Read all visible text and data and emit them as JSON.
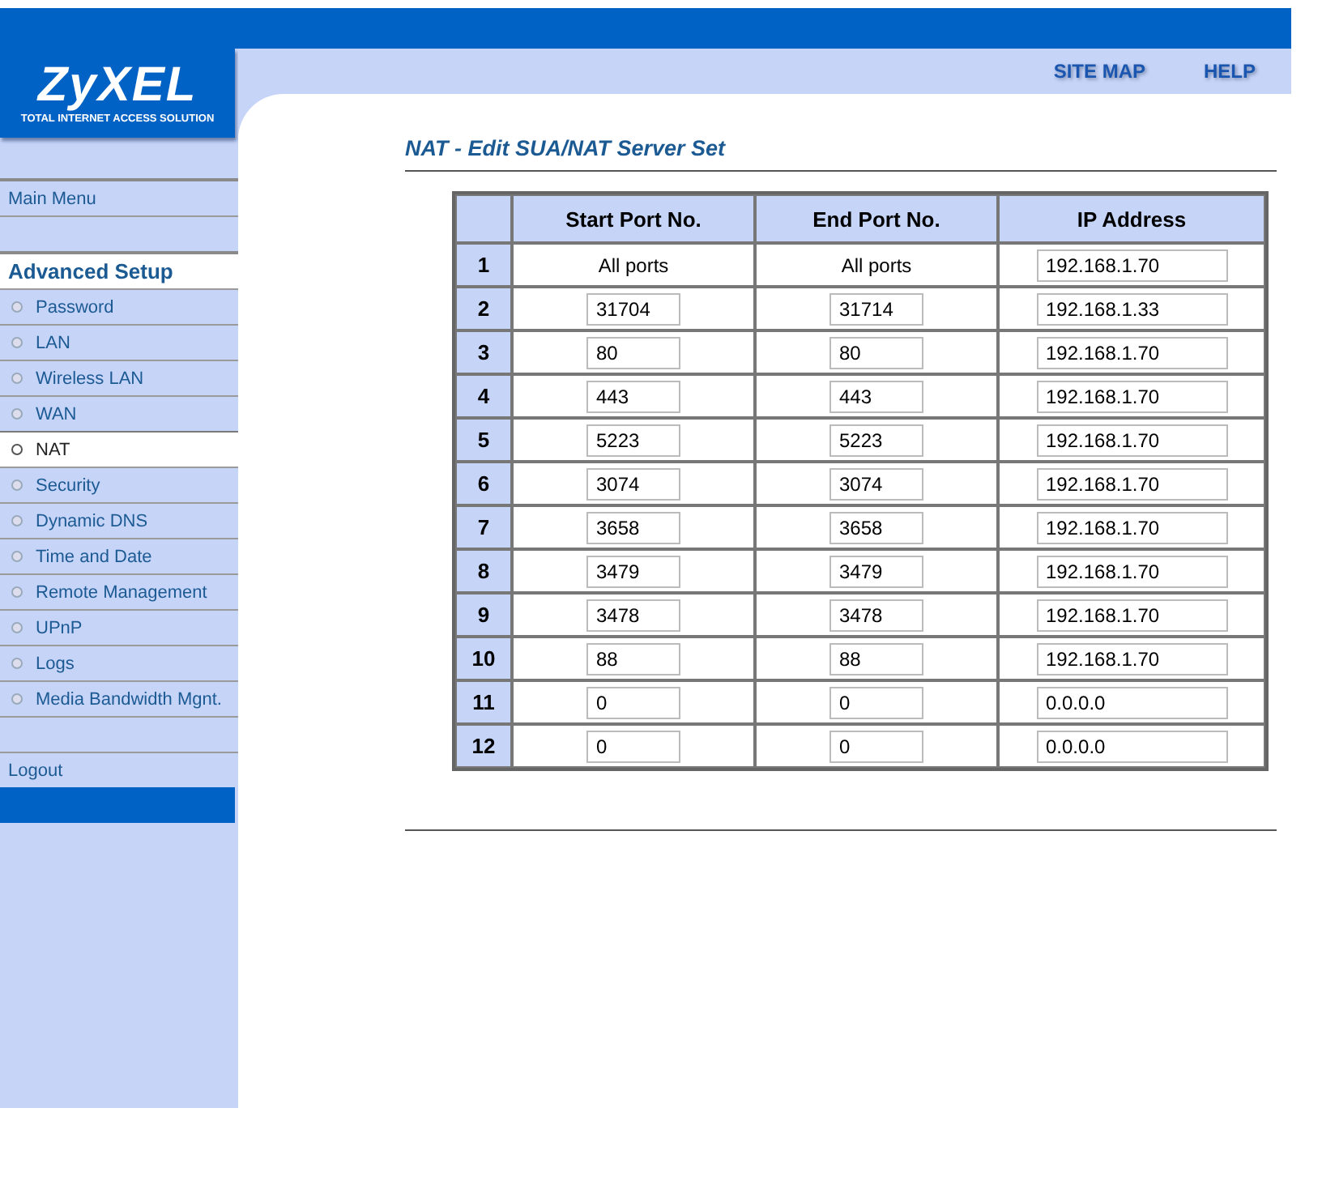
{
  "logo": {
    "brand": "ZyXEL",
    "tagline": "TOTAL INTERNET ACCESS SOLUTION"
  },
  "top_links": [
    "SITE MAP",
    "HELP"
  ],
  "sidebar": {
    "main_menu": "Main Menu",
    "section": "Advanced Setup",
    "items": [
      {
        "label": "Password",
        "selected": false
      },
      {
        "label": "LAN",
        "selected": false
      },
      {
        "label": "Wireless LAN",
        "selected": false
      },
      {
        "label": "WAN",
        "selected": false
      },
      {
        "label": "NAT",
        "selected": true
      },
      {
        "label": "Security",
        "selected": false
      },
      {
        "label": "Dynamic DNS",
        "selected": false
      },
      {
        "label": "Time and Date",
        "selected": false
      },
      {
        "label": "Remote Management",
        "selected": false
      },
      {
        "label": "UPnP",
        "selected": false
      },
      {
        "label": "Logs",
        "selected": false
      },
      {
        "label": "Media Bandwidth Mgnt.",
        "selected": false
      }
    ],
    "logout": "Logout"
  },
  "page_title": "NAT - Edit SUA/NAT Server Set",
  "table": {
    "columns": [
      "Start Port No.",
      "End Port No.",
      "IP Address"
    ],
    "rows": [
      {
        "number": "1",
        "start": {
          "kind": "text",
          "value": "All ports"
        },
        "end": {
          "kind": "text",
          "value": "All ports"
        },
        "ip": "192.168.1.70"
      },
      {
        "number": "2",
        "start": {
          "kind": "input",
          "value": "31704"
        },
        "end": {
          "kind": "input",
          "value": "31714"
        },
        "ip": "192.168.1.33"
      },
      {
        "number": "3",
        "start": {
          "kind": "input",
          "value": "80"
        },
        "end": {
          "kind": "input",
          "value": "80"
        },
        "ip": "192.168.1.70"
      },
      {
        "number": "4",
        "start": {
          "kind": "input",
          "value": "443"
        },
        "end": {
          "kind": "input",
          "value": "443"
        },
        "ip": "192.168.1.70"
      },
      {
        "number": "5",
        "start": {
          "kind": "input",
          "value": "5223"
        },
        "end": {
          "kind": "input",
          "value": "5223"
        },
        "ip": "192.168.1.70"
      },
      {
        "number": "6",
        "start": {
          "kind": "input",
          "value": "3074"
        },
        "end": {
          "kind": "input",
          "value": "3074"
        },
        "ip": "192.168.1.70"
      },
      {
        "number": "7",
        "start": {
          "kind": "input",
          "value": "3658"
        },
        "end": {
          "kind": "input",
          "value": "3658"
        },
        "ip": "192.168.1.70"
      },
      {
        "number": "8",
        "start": {
          "kind": "input",
          "value": "3479"
        },
        "end": {
          "kind": "input",
          "value": "3479"
        },
        "ip": "192.168.1.70"
      },
      {
        "number": "9",
        "start": {
          "kind": "input",
          "value": "3478"
        },
        "end": {
          "kind": "input",
          "value": "3478"
        },
        "ip": "192.168.1.70"
      },
      {
        "number": "10",
        "start": {
          "kind": "input",
          "value": "88"
        },
        "end": {
          "kind": "input",
          "value": "88"
        },
        "ip": "192.168.1.70"
      },
      {
        "number": "11",
        "start": {
          "kind": "input",
          "value": "0"
        },
        "end": {
          "kind": "input",
          "value": "0"
        },
        "ip": "0.0.0.0"
      },
      {
        "number": "12",
        "start": {
          "kind": "input",
          "value": "0"
        },
        "end": {
          "kind": "input",
          "value": "0"
        },
        "ip": "0.0.0.0"
      }
    ]
  }
}
